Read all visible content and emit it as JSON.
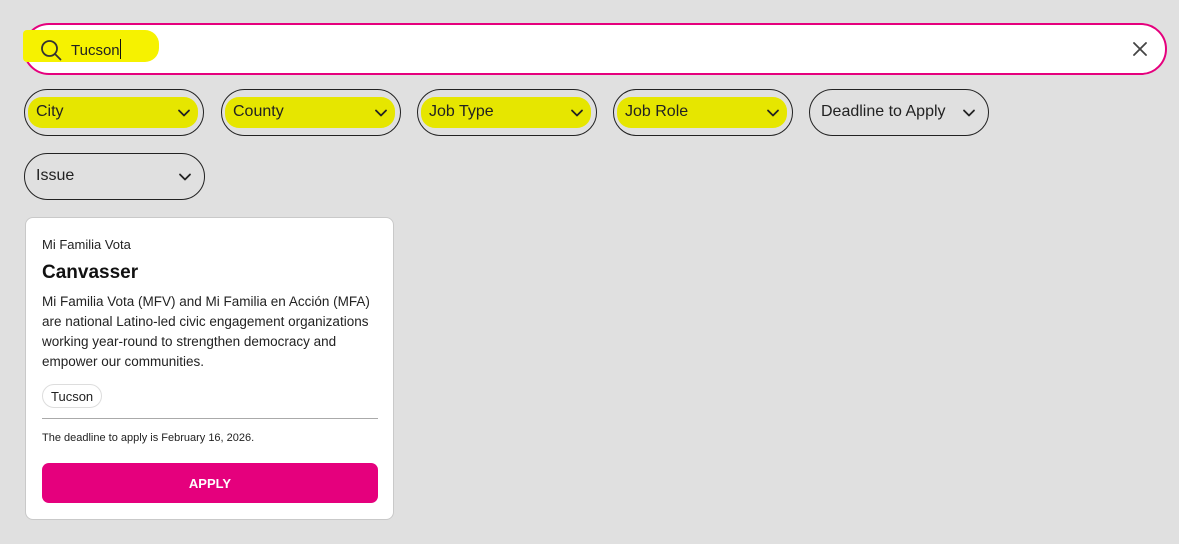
{
  "search": {
    "value": "Tucson",
    "placeholder": ""
  },
  "filters": [
    {
      "label": "City",
      "highlighted": true
    },
    {
      "label": "County",
      "highlighted": true
    },
    {
      "label": "Job Type",
      "highlighted": true
    },
    {
      "label": "Job Role",
      "highlighted": true
    },
    {
      "label": "Deadline to Apply",
      "highlighted": false
    },
    {
      "label": "Issue",
      "highlighted": false
    }
  ],
  "job": {
    "org": "Mi Familia Vota",
    "title": "Canvasser",
    "description": "Mi Familia Vota (MFV) and Mi Familia en Acción (MFA) are national Latino-led civic engagement organizations working year-round to strengthen democracy and empower our communities.",
    "tag": "Tucson",
    "deadline": "The deadline to apply is February 16, 2026.",
    "apply_label": "APPLY"
  },
  "colors": {
    "accent": "#e5007d",
    "highlight": "#e6e600",
    "background": "#e0e0e0"
  }
}
